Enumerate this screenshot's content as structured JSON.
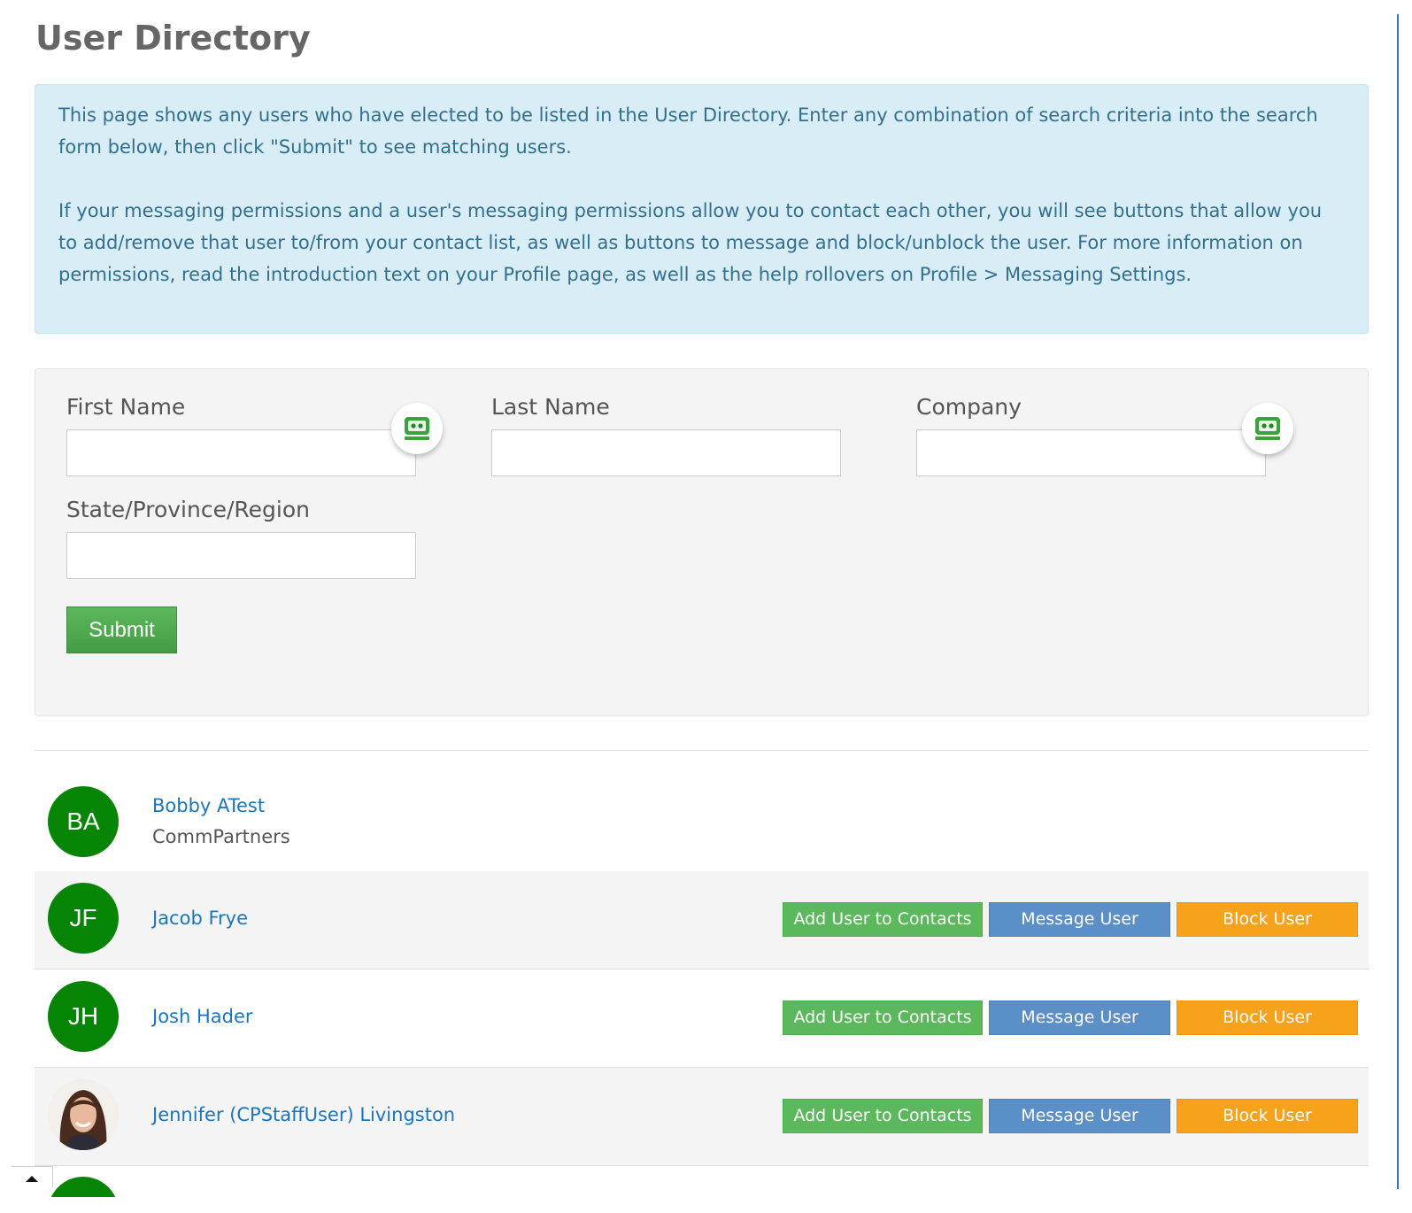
{
  "page": {
    "title": "User Directory"
  },
  "info": {
    "paragraph1": "This page shows any users who have elected to be listed in the User Directory. Enter any combination of search criteria into the search form below, then click \"Submit\" to see matching users.",
    "paragraph2": "If your messaging permissions and a user's messaging permissions allow you to contact each other, you will see buttons that allow you to add/remove that user to/from your contact list, as well as buttons to message and block/unblock the user. For more information on permissions, read the introduction text on your Profile page, as well as the help rollovers on Profile > Messaging Settings."
  },
  "search_form": {
    "first_name": {
      "label": "First Name",
      "value": ""
    },
    "last_name": {
      "label": "Last Name",
      "value": ""
    },
    "company": {
      "label": "Company",
      "value": ""
    },
    "region": {
      "label": "State/Province/Region",
      "value": ""
    },
    "submit_label": "Submit",
    "autofill_icon": "password-manager-icon"
  },
  "users": [
    {
      "initials": "BA",
      "name": "Bobby ATest",
      "company": "CommPartners",
      "has_photo": false,
      "actions": []
    },
    {
      "initials": "JF",
      "name": "Jacob Frye",
      "company": "",
      "has_photo": false,
      "actions": [
        "Add User to Contacts",
        "Message User",
        "Block User"
      ]
    },
    {
      "initials": "JH",
      "name": "Josh Hader",
      "company": "",
      "has_photo": false,
      "actions": [
        "Add User to Contacts",
        "Message User",
        "Block User"
      ]
    },
    {
      "initials": "",
      "name": "Jennifer (CPStaffUser) Livingston",
      "company": "",
      "has_photo": true,
      "actions": [
        "Add User to Contacts",
        "Message User",
        "Block User"
      ]
    }
  ],
  "colors": {
    "avatar_green": "#058406",
    "link_blue": "#1c75bc",
    "add_green": "#5cb85c",
    "message_blue": "#5b8fc7",
    "block_orange": "#f7a21b",
    "info_bg": "#d9edf7"
  },
  "scroll_top_icon": "caret-up-icon"
}
